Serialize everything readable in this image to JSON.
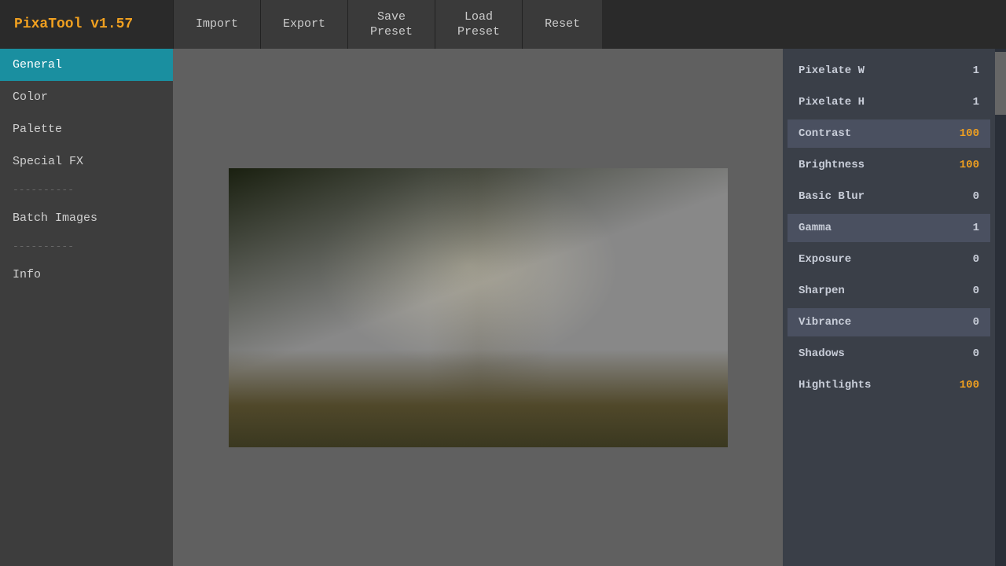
{
  "topbar": {
    "brand": "PixaTool v1.57",
    "buttons": [
      {
        "id": "import",
        "label": "Import"
      },
      {
        "id": "export",
        "label": "Export"
      },
      {
        "id": "save-preset",
        "label": "Save\nPreset"
      },
      {
        "id": "load-preset",
        "label": "Load\nPreset"
      },
      {
        "id": "reset",
        "label": "Reset"
      }
    ]
  },
  "sidebar": {
    "items": [
      {
        "id": "general",
        "label": "General",
        "active": true
      },
      {
        "id": "color",
        "label": "Color",
        "active": false
      },
      {
        "id": "palette",
        "label": "Palette",
        "active": false
      },
      {
        "id": "special-fx",
        "label": "Special FX",
        "active": false
      }
    ],
    "separator1": "----------",
    "extra_items": [
      {
        "id": "batch-images",
        "label": "Batch Images"
      }
    ],
    "separator2": "----------",
    "bottom_items": [
      {
        "id": "info",
        "label": "Info"
      }
    ]
  },
  "controls": [
    {
      "id": "pixelate-w",
      "label": "Pixelate W",
      "value": "1",
      "value_color": "white",
      "highlighted": false
    },
    {
      "id": "pixelate-h",
      "label": "Pixelate H",
      "value": "1",
      "value_color": "white",
      "highlighted": false
    },
    {
      "id": "contrast",
      "label": "Contrast",
      "value": "100",
      "value_color": "orange",
      "highlighted": true
    },
    {
      "id": "brightness",
      "label": "Brightness",
      "value": "100",
      "value_color": "orange",
      "highlighted": false
    },
    {
      "id": "basic-blur",
      "label": "Basic Blur",
      "value": "0",
      "value_color": "white",
      "highlighted": false
    },
    {
      "id": "gamma",
      "label": "Gamma",
      "value": "1",
      "value_color": "white",
      "highlighted": true
    },
    {
      "id": "exposure",
      "label": "Exposure",
      "value": "0",
      "value_color": "white",
      "highlighted": false
    },
    {
      "id": "sharpen",
      "label": "Sharpen",
      "value": "0",
      "value_color": "white",
      "highlighted": false
    },
    {
      "id": "vibrance",
      "label": "Vibrance",
      "value": "0",
      "value_color": "white",
      "highlighted": true
    },
    {
      "id": "shadows",
      "label": "Shadows",
      "value": "0",
      "value_color": "white",
      "highlighted": false
    },
    {
      "id": "highlights",
      "label": "Hightlights",
      "value": "100",
      "value_color": "orange",
      "highlighted": false
    }
  ]
}
